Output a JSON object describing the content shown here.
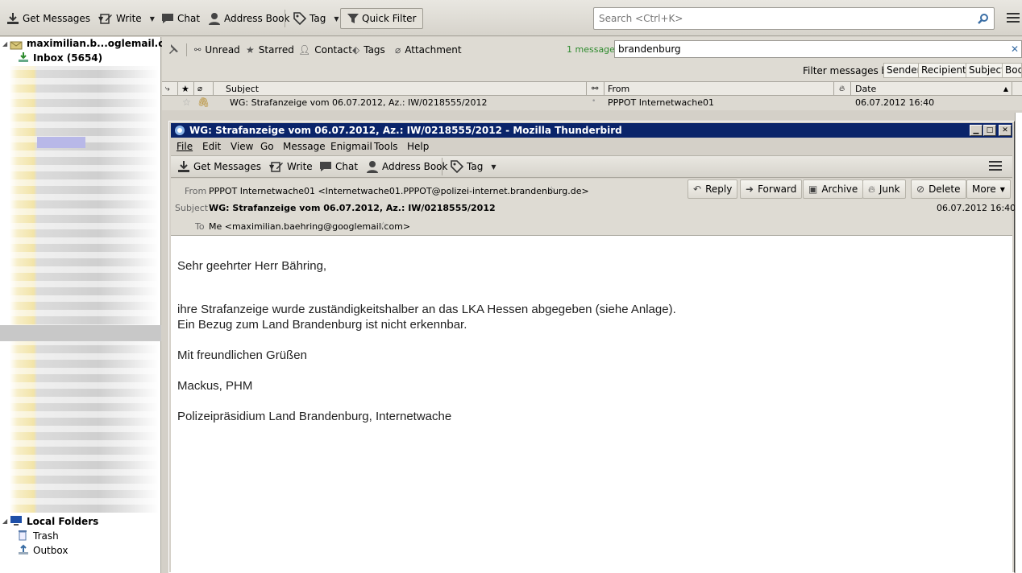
{
  "main_toolbar": {
    "get_messages": "Get Messages",
    "write": "Write",
    "chat": "Chat",
    "address_book": "Address Book",
    "tag": "Tag",
    "quick_filter": "Quick Filter",
    "search_placeholder": "Search <Ctrl+K>"
  },
  "folders": {
    "account": "maximilian.b...oglemail.com",
    "inbox": "Inbox (5654)",
    "local_folders": "Local Folders",
    "trash": "Trash",
    "outbox": "Outbox"
  },
  "quick_filter": {
    "unread": "Unread",
    "starred": "Starred",
    "contact": "Contact",
    "tags": "Tags",
    "attachment": "Attachment",
    "result_count": "1 message",
    "filter_text": "brandenburg",
    "filter_by_label": "Filter messages by:",
    "sender": "Sender",
    "recipients": "Recipients",
    "subject": "Subject",
    "body": "Body"
  },
  "thread_columns": {
    "subject": "Subject",
    "from": "From",
    "date": "Date"
  },
  "messages": [
    {
      "subject": "WG: Strafanzeige vom 06.07.2012, Az.: IW/0218555/2012",
      "from": "PPPOT Internetwache01",
      "date": "06.07.2012 16:40"
    }
  ],
  "message_window": {
    "title": "WG: Strafanzeige vom 06.07.2012, Az.: IW/0218555/2012 - Mozilla Thunderbird",
    "menu": [
      "File",
      "Edit",
      "View",
      "Go",
      "Message",
      "Enigmail",
      "Tools",
      "Help"
    ],
    "toolbar": {
      "get_messages": "Get Messages",
      "write": "Write",
      "chat": "Chat",
      "address_book": "Address Book",
      "tag": "Tag"
    },
    "header": {
      "from_label": "From",
      "from_value": "PPPOT Internetwache01 <Internetwache01.PPPOT@polizei-internet.brandenburg.de>",
      "subject_label": "Subject",
      "subject_value": "WG: Strafanzeige vom 06.07.2012, Az.: IW/0218555/2012",
      "to_label": "To",
      "to_value": "Me <maximilian.baehring@googlemail.com>",
      "date": "06.07.2012 16:40"
    },
    "actions": {
      "reply": "Reply",
      "forward": "Forward",
      "archive": "Archive",
      "junk": "Junk",
      "delete": "Delete",
      "more": "More"
    },
    "body": {
      "greeting": "Sehr geehrter Herr Bähring,",
      "line1": "ihre Strafanzeige wurde zuständigkeitshalber an das LKA Hessen abgegeben (siehe Anlage).",
      "line2": "Ein Bezug zum Land Brandenburg ist nicht erkennbar.",
      "closing": "Mit freundlichen Grüßen",
      "signature": "Mackus, PHM",
      "organization": "Polizeipräsidium Land Brandenburg, Internetwache"
    }
  }
}
